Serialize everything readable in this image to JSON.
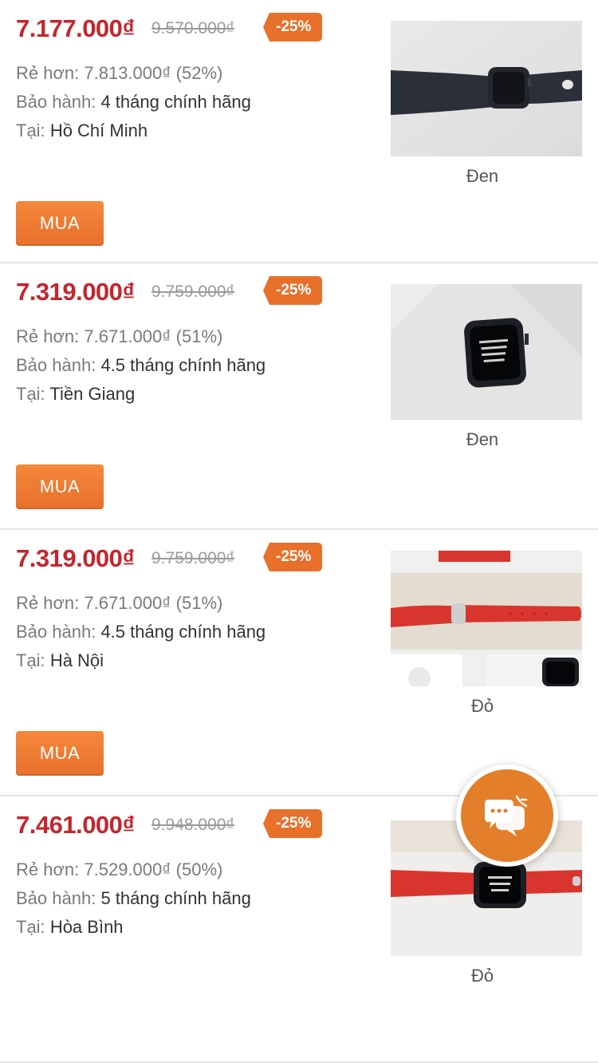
{
  "labels": {
    "cheaper": "Rẻ hơn:",
    "warranty": "Bảo hành:",
    "location": "Tại:",
    "buy": "MUA"
  },
  "listings": [
    {
      "price": "7.177.000₫",
      "old_price": "9.570.000₫",
      "discount": "-25%",
      "cheaper": "7.813.000₫ (52%)",
      "warranty": "4 tháng chính hãng",
      "location": "Hồ Chí Minh",
      "color": "Đen"
    },
    {
      "price": "7.319.000₫",
      "old_price": "9.759.000₫",
      "discount": "-25%",
      "cheaper": "7.671.000₫ (51%)",
      "warranty": "4.5 tháng chính hãng",
      "location": "Tiền Giang",
      "color": "Đen"
    },
    {
      "price": "7.319.000₫",
      "old_price": "9.759.000₫",
      "discount": "-25%",
      "cheaper": "7.671.000₫ (51%)",
      "warranty": "4.5 tháng chính hãng",
      "location": "Hà Nội",
      "color": "Đỏ"
    },
    {
      "price": "7.461.000₫",
      "old_price": "9.948.000₫",
      "discount": "-25%",
      "cheaper": "7.529.000₫ (50%)",
      "warranty": "5 tháng chính hãng",
      "location": "Hòa Bình",
      "color": "Đỏ"
    }
  ],
  "colors": {
    "price": "#c5252d",
    "accent": "#e8702b",
    "badge": "#e8702b",
    "chat": "#e37f2b"
  },
  "chat_button": {
    "icon": "chat-bubbles-icon"
  }
}
